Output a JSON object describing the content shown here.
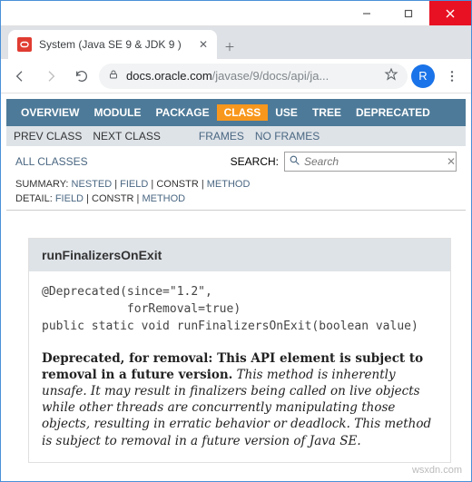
{
  "window": {
    "tab_title": "System (Java SE 9 & JDK 9 )",
    "url_host": "docs.oracle.com",
    "url_path": "/javase/9/docs/api/ja...",
    "avatar_letter": "R"
  },
  "nav": {
    "items": [
      "OVERVIEW",
      "MODULE",
      "PACKAGE",
      "CLASS",
      "USE",
      "TREE",
      "DEPRECATED"
    ],
    "active_index": 3
  },
  "subnav": {
    "prev": "PREV CLASS",
    "next": "NEXT CLASS",
    "frames": "FRAMES",
    "noframes": "NO FRAMES"
  },
  "allclasses": "ALL CLASSES",
  "search": {
    "label": "SEARCH:",
    "placeholder": "Search"
  },
  "summary": {
    "label": "SUMMARY:",
    "nested": "NESTED",
    "field": "FIELD",
    "constr": "CONSTR",
    "method": "METHOD"
  },
  "detail": {
    "label": "DETAIL:",
    "field": "FIELD",
    "constr": "CONSTR",
    "method": "METHOD"
  },
  "method": {
    "name": "runFinalizersOnExit",
    "sig_line1": "@Deprecated(since=\"1.2\",",
    "sig_line2": "            forRemoval=true)",
    "sig_line3": "public static void runFinalizersOnExit(boolean value)",
    "dep_bold": "Deprecated, for removal: This API element is subject to removal in a future version.",
    "dep_rest": " This method is inherently unsafe. It may result in finalizers being called on live objects while other threads are concurrently manipulating those objects, resulting in erratic behavior or deadlock. This method is subject to removal in a future version of Java SE."
  },
  "watermark": "wsxdn.com"
}
